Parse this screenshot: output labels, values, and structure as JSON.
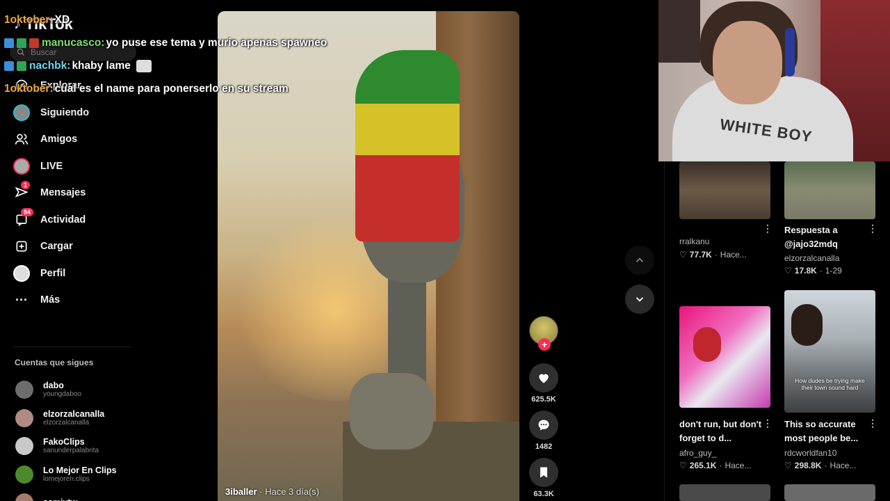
{
  "app": {
    "logo": "TikTok"
  },
  "search": {
    "placeholder": "Buscar"
  },
  "nav": [
    {
      "label": "Explorar"
    },
    {
      "label": "Siguiendo"
    },
    {
      "label": "Amigos"
    },
    {
      "label": "LIVE"
    },
    {
      "label": "Mensajes",
      "badge": "1"
    },
    {
      "label": "Actividad",
      "badge": "94"
    },
    {
      "label": "Cargar"
    },
    {
      "label": "Perfil"
    },
    {
      "label": "Más"
    }
  ],
  "following": {
    "title": "Cuentas que sigues",
    "items": [
      {
        "name": "dabo",
        "handle": "youngdaboo"
      },
      {
        "name": "elzorzalcanalla",
        "handle": "elzorzalcanalla"
      },
      {
        "name": "FakoClips",
        "handle": "sanunderpalabrita"
      },
      {
        "name": "Lo Mejor En Clips",
        "handle": "lomejoren.clips"
      },
      {
        "name": "samivtw",
        "handle": ""
      }
    ]
  },
  "chat": [
    {
      "user": "1oktober:",
      "message": "XD"
    },
    {
      "user": "manucasco:",
      "message": "yo puse ese tema y murio apenas spawneo"
    },
    {
      "user": "nachbk:",
      "message": "khaby lame"
    },
    {
      "user": "1oktober:",
      "message": "cual es el name para ponerserlo en su stream"
    }
  ],
  "video": {
    "author": "3iballer",
    "time": " · Hace 3 día(s)"
  },
  "actions": {
    "likes": "625.5K",
    "comments": "1482",
    "saves": "63.3K"
  },
  "webcam": {
    "shirt_text": "WHITE BOY"
  },
  "grid": [
    {
      "title": "",
      "user": "rralkanu",
      "likes": "77.7K",
      "date": "Hace..."
    },
    {
      "title": "Respuesta a @jajo32mdq",
      "user": "elzorzalcanalla",
      "likes": "17.8K",
      "date": "1-29"
    },
    {
      "title": "don't run, but don't forget to d...",
      "user": "afro_guy_",
      "likes": "265.1K",
      "date": "Hace..."
    },
    {
      "title": "This so accurate most people be...",
      "user": "rdcworldfan10",
      "likes": "298.8K",
      "date": "Hace...",
      "thumb_caption": "How dudes be trying make their town sound hard"
    }
  ],
  "colors": {
    "accent": "#fe2c55",
    "chat_user_orange": "#f0a93c",
    "chat_user_green": "#7de070",
    "chat_user_cyan": "#6fd7f0"
  }
}
